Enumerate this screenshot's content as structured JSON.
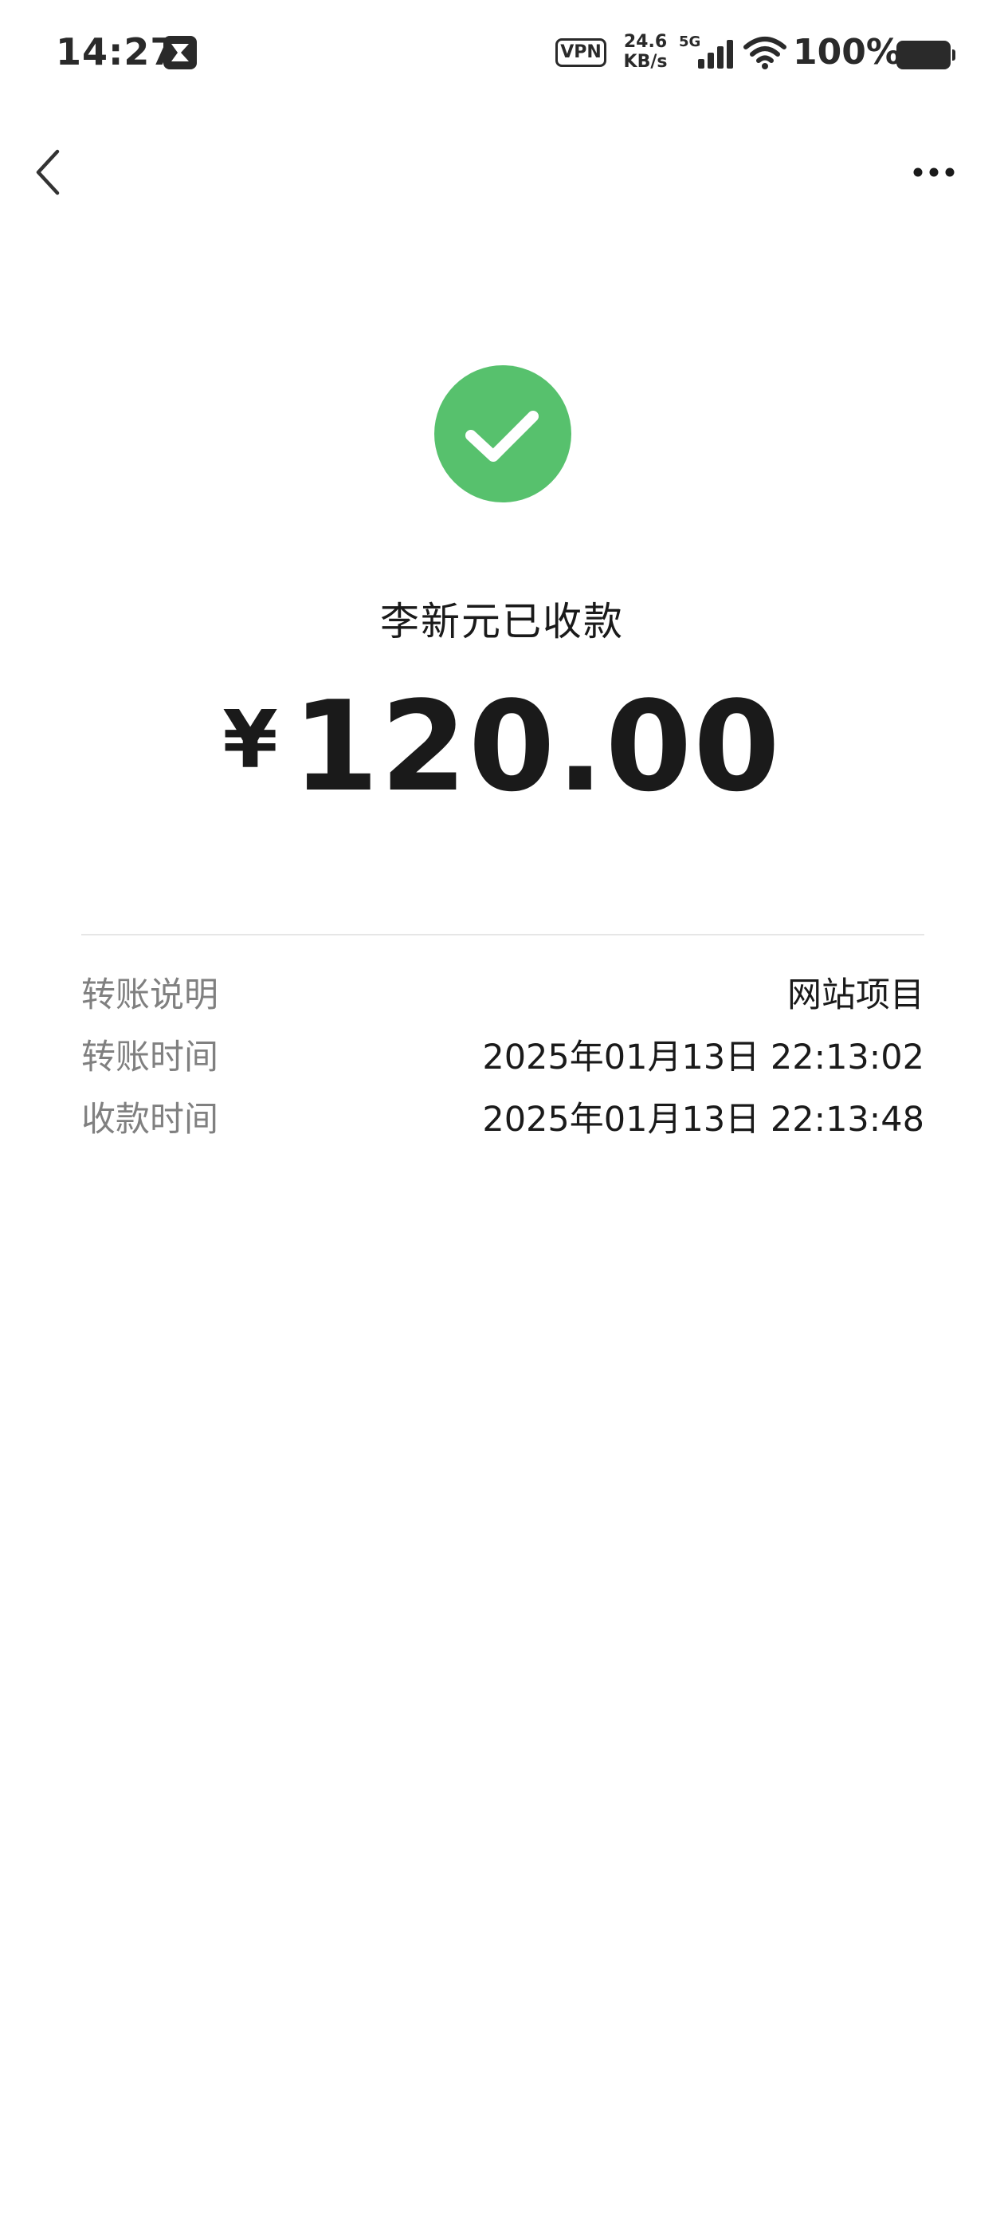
{
  "status_bar": {
    "time": "14:27",
    "vpn_label": "VPN",
    "net_speed_value": "24.6",
    "net_speed_unit": "KB/s",
    "network_type": "5G",
    "battery_text": "100%"
  },
  "nav": {
    "back_icon": "chevron-left-icon",
    "more_icon": "more-horizontal-icon"
  },
  "status": {
    "icon": "check-circle-icon",
    "color": "#57c16d",
    "title": "李新元已收款"
  },
  "amount": {
    "currency": "¥",
    "value": "120.00"
  },
  "details": [
    {
      "label": "转账说明",
      "value": "网站项目"
    },
    {
      "label": "转账时间",
      "value": "2025年01月13日 22:13:02"
    },
    {
      "label": "收款时间",
      "value": "2025年01月13日 22:13:48"
    }
  ]
}
